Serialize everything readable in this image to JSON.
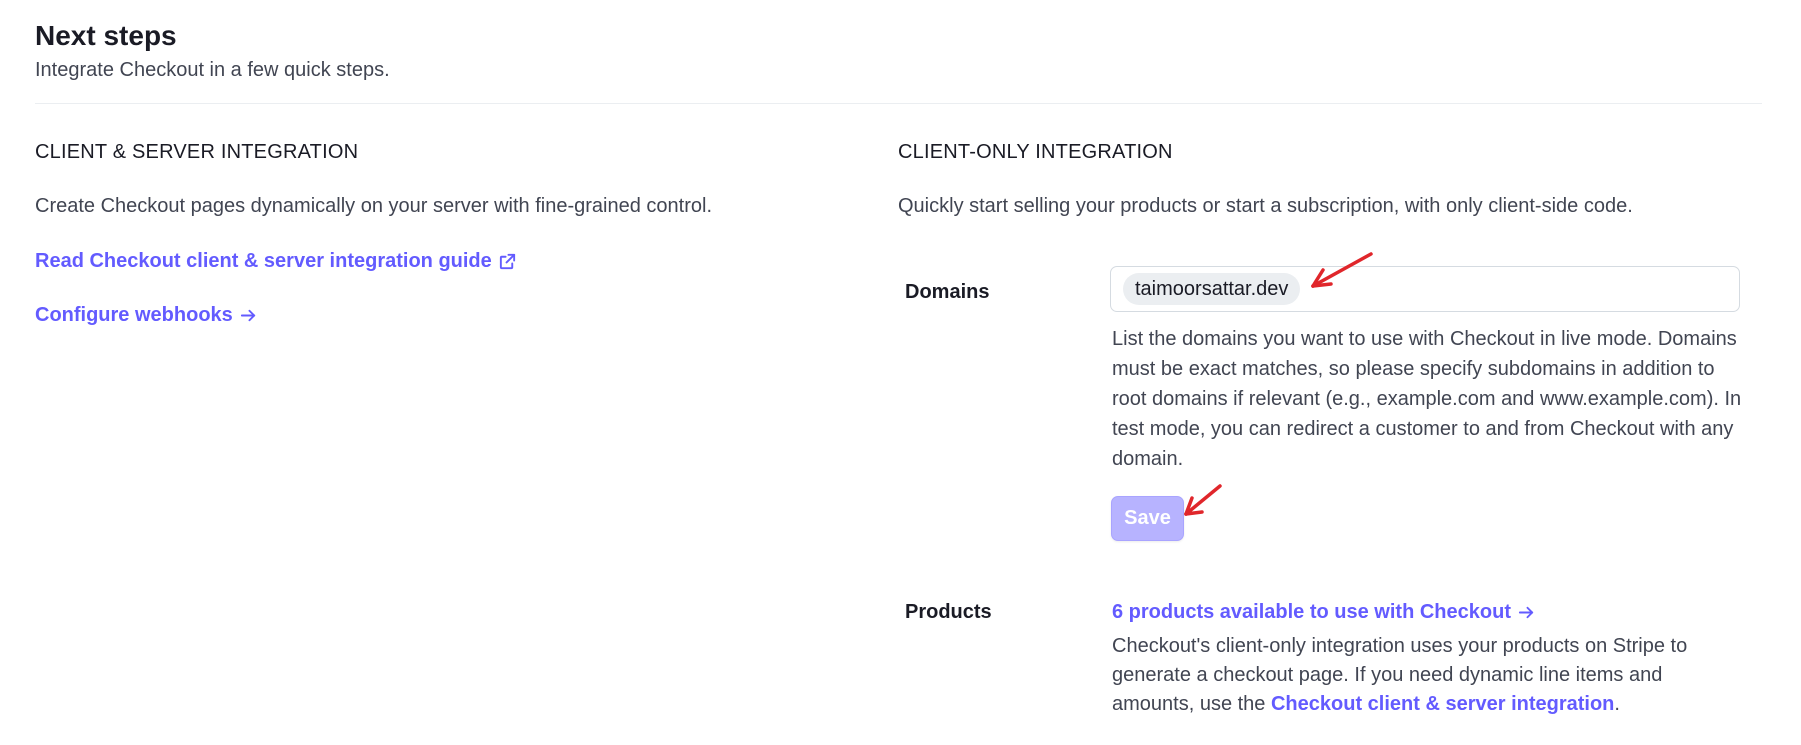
{
  "header": {
    "title": "Next steps",
    "subtitle": "Integrate Checkout in a few quick steps."
  },
  "client_server": {
    "heading": "CLIENT & SERVER INTEGRATION",
    "description": "Create Checkout pages dynamically on your server with fine-grained control.",
    "guide_link": "Read Checkout client & server integration guide",
    "webhooks_link": "Configure webhooks"
  },
  "client_only": {
    "heading": "CLIENT-ONLY INTEGRATION",
    "description": "Quickly start selling your products or start a subscription, with only client-side code.",
    "domains": {
      "label": "Domains",
      "chips": [
        "taimoorsattar.dev"
      ],
      "help": "List the domains you want to use with Checkout in live mode. Domains must be exact matches, so please specify subdomains in addition to root domains if relevant (e.g., example.com and www.example.com). In test mode, you can redirect a customer to and from Checkout with any domain."
    },
    "save_label": "Save",
    "products": {
      "label": "Products",
      "link": "6 products available to use with Checkout",
      "help_prefix": "Checkout's client-only integration uses your products on Stripe to generate a checkout page. If you need dynamic line items and amounts, use the ",
      "help_link": "Checkout client & server integration",
      "help_suffix": "."
    }
  },
  "colors": {
    "link": "#635bff",
    "save_disabled": "#b7b3ff",
    "annotation": "#e0262b"
  }
}
